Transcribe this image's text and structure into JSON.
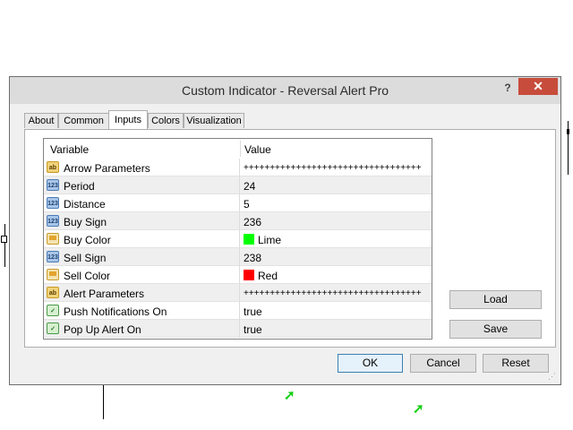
{
  "window": {
    "title": "Custom Indicator - Reversal Alert Pro",
    "help_label": "?",
    "close_label": "✕"
  },
  "tabs": [
    {
      "label": "About"
    },
    {
      "label": "Common"
    },
    {
      "label": "Inputs",
      "active": true
    },
    {
      "label": "Colors"
    },
    {
      "label": "Visualization"
    }
  ],
  "grid": {
    "headers": {
      "variable": "Variable",
      "value": "Value"
    },
    "rows": [
      {
        "icon": "ab-string-icon",
        "variable": "Arrow Parameters",
        "value": "++++++++++++++++++++++++++++++++++"
      },
      {
        "icon": "123-number-icon",
        "variable": "Period",
        "value": "24"
      },
      {
        "icon": "123-number-icon",
        "variable": "Distance",
        "value": "5"
      },
      {
        "icon": "123-number-icon",
        "variable": "Buy Sign",
        "value": "236"
      },
      {
        "icon": "color-icon",
        "variable": "Buy Color",
        "value": "Lime",
        "color": "#00ff00"
      },
      {
        "icon": "123-number-icon",
        "variable": "Sell Sign",
        "value": "238"
      },
      {
        "icon": "color-icon",
        "variable": "Sell Color",
        "value": "Red",
        "color": "#ff0000"
      },
      {
        "icon": "ab-string-icon",
        "variable": "Alert Parameters",
        "value": "++++++++++++++++++++++++++++++++++"
      },
      {
        "icon": "bool-icon",
        "variable": "Push Notifications On",
        "value": "true"
      },
      {
        "icon": "bool-icon",
        "variable": "Pop Up Alert On",
        "value": "true"
      }
    ]
  },
  "side_buttons": {
    "load": "Load",
    "save": "Save"
  },
  "footer_buttons": {
    "ok": "OK",
    "cancel": "Cancel",
    "reset": "Reset"
  },
  "colors": {
    "accent": "#3c7fb1",
    "close": "#c74c3c",
    "arrow": "#18d018"
  }
}
